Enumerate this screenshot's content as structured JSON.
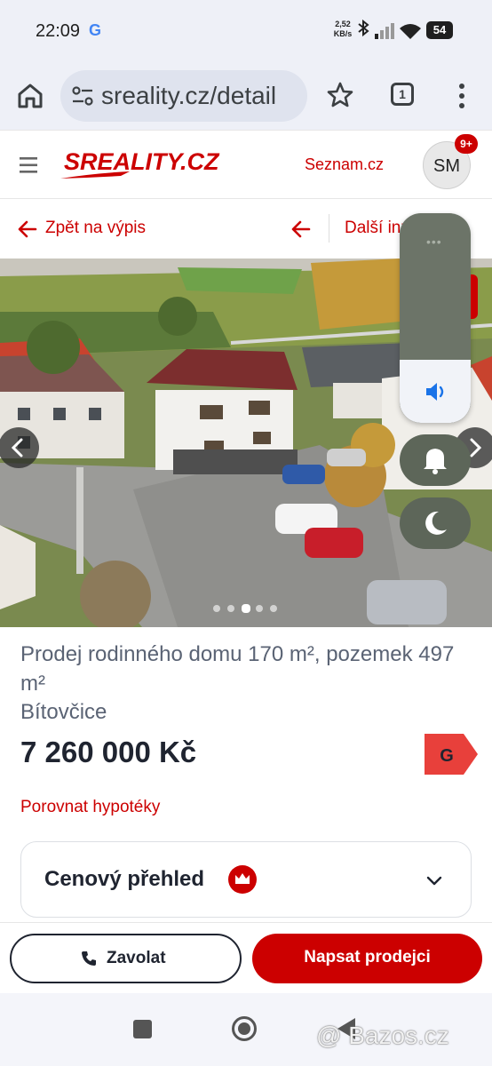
{
  "status_bar": {
    "time": "22:09",
    "google_badge": "G",
    "network_speed": "2,52 KB/s",
    "battery": "54",
    "icons": [
      "bluetooth-icon",
      "signal-icon",
      "wifi-icon",
      "battery-icon"
    ]
  },
  "browser": {
    "url": "sreality.cz/detail",
    "tab_count": "1",
    "icons": [
      "home-icon",
      "site-settings-icon",
      "bookmark-star-icon",
      "tabs-icon",
      "overflow-menu-icon"
    ]
  },
  "header": {
    "logo_text": "SREALITY.CZ",
    "seznam_link": "Seznam.cz",
    "avatar_initials": "SM",
    "notification_badge": "9+"
  },
  "nav": {
    "back_label": "Zpět na výpis",
    "next_label": "Další inzerát"
  },
  "gallery": {
    "total_images": 5,
    "active_index": 2
  },
  "volume_overlay": {
    "level": 0.3,
    "handle": "•••"
  },
  "listing": {
    "title": "Prodej rodinného domu 170 m², pozemek 497 m²",
    "location": "Bítovčice",
    "price": "7 260 000 Kč",
    "energy_class": "G",
    "mortgage_link": "Porovnat hypotéky"
  },
  "price_overview": {
    "title": "Cenový přehled"
  },
  "actions": {
    "call_label": "Zavolat",
    "write_label": "Napsat prodejci"
  },
  "watermark": "@ Bazos.cz",
  "colors": {
    "brand_red": "#cc0000",
    "text_dark": "#1f2430",
    "text_muted": "#5a6374",
    "browser_bg": "#eef0f7"
  }
}
